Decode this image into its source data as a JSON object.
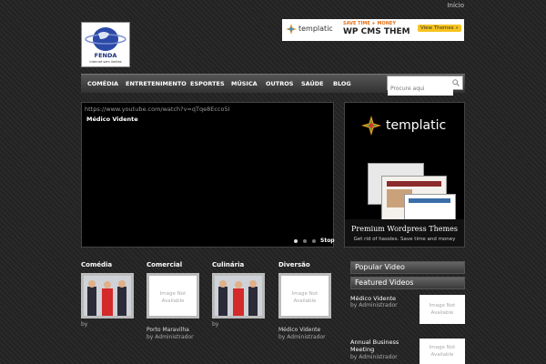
{
  "header": {
    "top_link": "Início",
    "logo_text": "FENDA",
    "logo_tagline": "Internet sem limites"
  },
  "banner": {
    "brand": "templatic",
    "tagline": "SAVE TIME + MONEY",
    "headline": "WP CMS THEM",
    "button": "View Themes »"
  },
  "nav": {
    "items": [
      "COMÉDIA",
      "ENTRETENIMENTO",
      "ESPORTES",
      "MÚSICA",
      "OUTROS",
      "SAÚDE",
      "BLOG"
    ]
  },
  "search": {
    "placeholder": "Procure aqui"
  },
  "video": {
    "url": "https://www.youtube.com/watch?v=qTqe8Ecco5I",
    "title": "Médico Vidente",
    "stop_label": "Stop"
  },
  "ad": {
    "brand": "templatic",
    "title": "Premium Wordpress Themes",
    "subtitle": "Get rid of hassles. Save time and money"
  },
  "categories": [
    {
      "title": "Comédia",
      "caption": "",
      "author": "by"
    },
    {
      "title": "Comercial",
      "image_text": "Image Not Available",
      "caption": "Porto Maravilha",
      "author": "by Administrador"
    },
    {
      "title": "Culinária",
      "caption": "",
      "author": "by"
    },
    {
      "title": "Diversão",
      "image_text": "Image Not Available",
      "caption": "Médico Vidente",
      "author": "by Administrador"
    }
  ],
  "sidebar": {
    "popular_title": "Popular Video",
    "featured_title": "Featured Videos",
    "items": [
      {
        "title": "Médico Vidente",
        "author": "by Administrador",
        "image_text": "Image Not Available"
      },
      {
        "title": "Annual Business Meeting",
        "author": "by Administrador",
        "image_text": "Image Not Available"
      }
    ]
  },
  "colors": {
    "accent": "#ff9a1a",
    "nav_bg": "#3a3a3a",
    "page_bg": "#262626"
  }
}
